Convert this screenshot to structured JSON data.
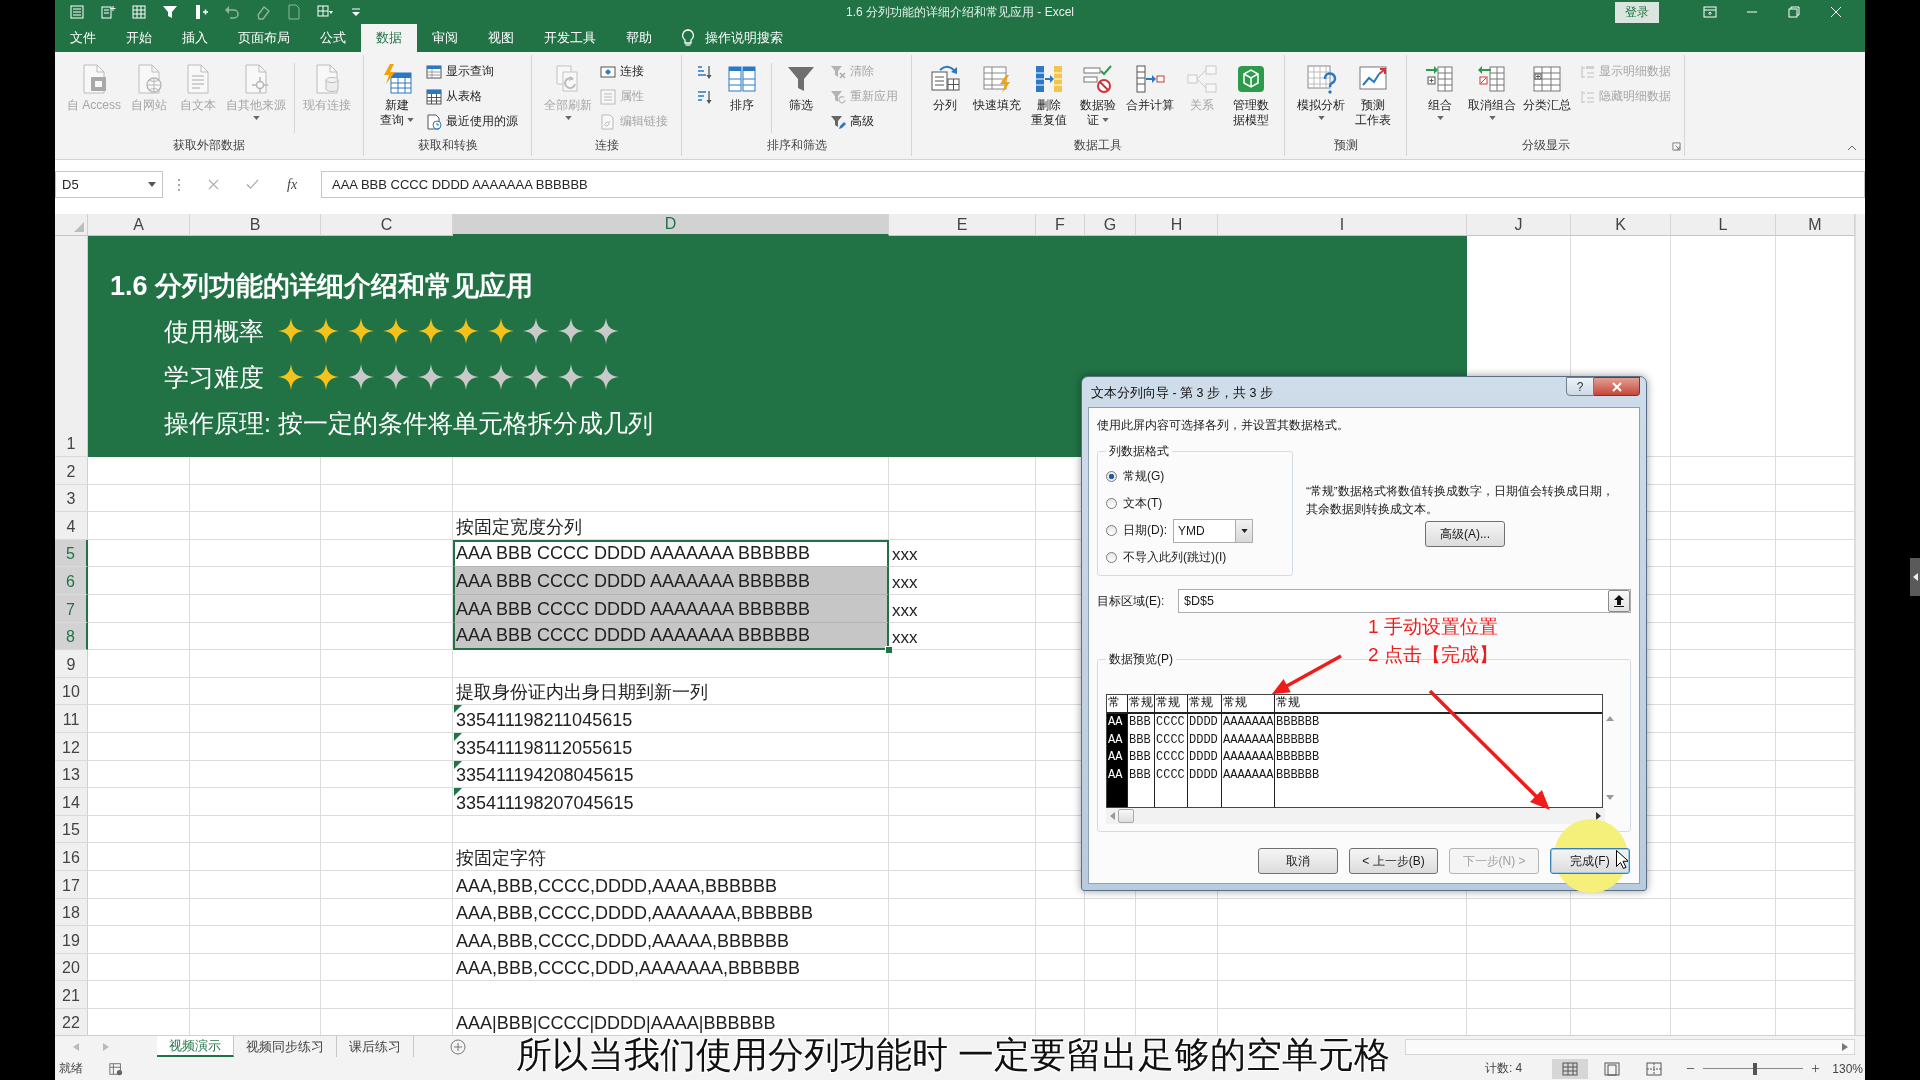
{
  "window": {
    "title": "1.6 分列功能的详细介绍和常见应用 - Excel",
    "sign_in": "登录"
  },
  "ribbon": {
    "tabs": [
      {
        "label": "文件",
        "selected": false
      },
      {
        "label": "开始",
        "selected": false
      },
      {
        "label": "插入",
        "selected": false
      },
      {
        "label": "页面布局",
        "selected": false
      },
      {
        "label": "公式",
        "selected": false
      },
      {
        "label": "数据",
        "selected": true
      },
      {
        "label": "审阅",
        "selected": false
      },
      {
        "label": "视图",
        "selected": false
      },
      {
        "label": "开发工具",
        "selected": false
      },
      {
        "label": "帮助",
        "selected": false
      }
    ],
    "tell_me": "操作说明搜索",
    "groups": [
      {
        "label": "获取外部数据",
        "launcher": false,
        "columns": [
          {
            "kind": "large",
            "lines": [
              "自 Access"
            ],
            "disabled": true,
            "dropdown": false
          },
          {
            "kind": "large",
            "lines": [
              "自网站"
            ],
            "disabled": true,
            "dropdown": false
          },
          {
            "kind": "large",
            "lines": [
              "自文本"
            ],
            "disabled": true,
            "dropdown": false
          },
          {
            "kind": "large",
            "lines": [
              "自其他来源"
            ],
            "disabled": true,
            "dropdown": true
          },
          {
            "kind": "divider"
          },
          {
            "kind": "large",
            "lines": [
              "现有连接"
            ],
            "disabled": true,
            "dropdown": false
          }
        ]
      },
      {
        "label": "获取和转换",
        "launcher": false,
        "columns": [
          {
            "kind": "large",
            "lines": [
              "新建",
              "查询"
            ],
            "disabled": false,
            "dropdown": true
          },
          {
            "kind": "stack",
            "buttons": [
              {
                "kind": "small",
                "label": "显示查询",
                "disabled": false
              },
              {
                "kind": "small",
                "label": "从表格",
                "disabled": false
              },
              {
                "kind": "small",
                "label": "最近使用的源",
                "disabled": false
              }
            ]
          }
        ]
      },
      {
        "label": "连接",
        "launcher": false,
        "columns": [
          {
            "kind": "large",
            "lines": [
              "全部刷新"
            ],
            "disabled": true,
            "dropdown": true
          },
          {
            "kind": "stack",
            "buttons": [
              {
                "kind": "small",
                "label": "连接",
                "disabled": false
              },
              {
                "kind": "small",
                "label": "属性",
                "disabled": true
              },
              {
                "kind": "small",
                "label": "编辑链接",
                "disabled": true
              }
            ]
          }
        ]
      },
      {
        "label": "排序和筛选",
        "launcher": false,
        "columns": [
          {
            "kind": "stack",
            "buttons": [
              {
                "kind": "icon",
                "disabled": false
              },
              {
                "kind": "icon",
                "disabled": false
              }
            ]
          },
          {
            "kind": "large",
            "lines": [
              "排序"
            ],
            "disabled": false,
            "dropdown": false
          },
          {
            "kind": "divider"
          },
          {
            "kind": "large",
            "lines": [
              "筛选"
            ],
            "disabled": false,
            "dropdown": false
          },
          {
            "kind": "stack",
            "buttons": [
              {
                "kind": "small",
                "label": "清除",
                "disabled": true
              },
              {
                "kind": "small",
                "label": "重新应用",
                "disabled": true
              },
              {
                "kind": "small",
                "label": "高级",
                "disabled": false
              }
            ]
          }
        ]
      },
      {
        "label": "数据工具",
        "launcher": false,
        "columns": [
          {
            "kind": "large",
            "lines": [
              "分列"
            ],
            "disabled": false,
            "dropdown": false
          },
          {
            "kind": "large",
            "lines": [
              "快速填充"
            ],
            "disabled": false,
            "dropdown": false
          },
          {
            "kind": "large",
            "lines": [
              "删除",
              "重复值"
            ],
            "disabled": false,
            "dropdown": false
          },
          {
            "kind": "large",
            "lines": [
              "数据验",
              "证"
            ],
            "disabled": false,
            "dropdown": true
          },
          {
            "kind": "large",
            "lines": [
              "合并计算"
            ],
            "disabled": false,
            "dropdown": false
          },
          {
            "kind": "large",
            "lines": [
              "关系"
            ],
            "disabled": true,
            "dropdown": false
          },
          {
            "kind": "large",
            "lines": [
              "管理数",
              "据模型"
            ],
            "disabled": false,
            "dropdown": false
          }
        ]
      },
      {
        "label": "预测",
        "launcher": false,
        "columns": [
          {
            "kind": "large",
            "lines": [
              "模拟分析"
            ],
            "disabled": false,
            "dropdown": true
          },
          {
            "kind": "large",
            "lines": [
              "预测",
              "工作表"
            ],
            "disabled": false,
            "dropdown": false
          }
        ]
      },
      {
        "label": "分级显示",
        "launcher": true,
        "columns": [
          {
            "kind": "large",
            "lines": [
              "组合"
            ],
            "disabled": false,
            "dropdown": true
          },
          {
            "kind": "large",
            "lines": [
              "取消组合"
            ],
            "disabled": false,
            "dropdown": true
          },
          {
            "kind": "large",
            "lines": [
              "分类汇总"
            ],
            "disabled": false,
            "dropdown": false
          },
          {
            "kind": "stack",
            "buttons": [
              {
                "kind": "small",
                "label": "显示明细数据",
                "disabled": true
              },
              {
                "kind": "small",
                "label": "隐藏明细数据",
                "disabled": true
              }
            ]
          }
        ]
      }
    ]
  },
  "formula_bar": {
    "name_box": "D5",
    "function_label": "fx",
    "value": "AAA BBB CCCC DDDD AAAAAAA BBBBBB"
  },
  "sheet": {
    "columns": [
      {
        "label": "A",
        "selected": false
      },
      {
        "label": "B",
        "selected": false
      },
      {
        "label": "C",
        "selected": false
      },
      {
        "label": "D",
        "selected": true
      },
      {
        "label": "E",
        "selected": false
      },
      {
        "label": "F",
        "selected": false
      },
      {
        "label": "G",
        "selected": false
      },
      {
        "label": "H",
        "selected": false
      },
      {
        "label": "I",
        "selected": false
      },
      {
        "label": "J",
        "selected": false
      },
      {
        "label": "K",
        "selected": false
      },
      {
        "label": "L",
        "selected": false
      },
      {
        "label": "M",
        "selected": false
      }
    ],
    "rows": [
      {
        "label": "1",
        "selected": false,
        "banner": {
          "title": "1.6 分列功能的详细介绍和常见应用",
          "ratings": [
            {
              "label": "使用概率",
              "stars": 7
            },
            {
              "label": "学习难度",
              "stars": 2
            }
          ],
          "principle": "操作原理: 按一定的条件将单元格拆分成几列"
        }
      },
      {
        "label": "2",
        "selected": false
      },
      {
        "label": "3",
        "selected": false
      },
      {
        "label": "4",
        "selected": false,
        "column_d": {
          "text": "按固定宽度分列",
          "selected": false,
          "active": false,
          "flagged": false
        }
      },
      {
        "label": "5",
        "selected": true,
        "column_d": {
          "text": "AAA BBB CCCC DDDD AAAAAAA BBBBBB",
          "selected": true,
          "active": true,
          "flagged": false
        },
        "column_e": {
          "text": "xxx"
        }
      },
      {
        "label": "6",
        "selected": true,
        "column_d": {
          "text": "AAA BBB CCCC DDDD AAAAAAA BBBBBB",
          "selected": true,
          "active": false,
          "flagged": false
        },
        "column_e": {
          "text": "xxx"
        }
      },
      {
        "label": "7",
        "selected": true,
        "column_d": {
          "text": "AAA BBB CCCC DDDD AAAAAAA BBBBBB",
          "selected": true,
          "active": false,
          "flagged": false
        },
        "column_e": {
          "text": "xxx"
        }
      },
      {
        "label": "8",
        "selected": true,
        "column_d": {
          "text": "AAA BBB CCCC DDDD AAAAAAA BBBBBB",
          "selected": true,
          "active": false,
          "flagged": false
        },
        "column_e": {
          "text": "xxx"
        }
      },
      {
        "label": "9",
        "selected": false
      },
      {
        "label": "10",
        "selected": false,
        "column_d": {
          "text": "提取身份证内出身日期到新一列",
          "selected": false,
          "active": false,
          "flagged": false
        }
      },
      {
        "label": "11",
        "selected": false,
        "column_d": {
          "text": "335411198211045615",
          "selected": false,
          "active": false,
          "flagged": true
        }
      },
      {
        "label": "12",
        "selected": false,
        "column_d": {
          "text": "335411198112055615",
          "selected": false,
          "active": false,
          "flagged": true
        }
      },
      {
        "label": "13",
        "selected": false,
        "column_d": {
          "text": "335411194208045615",
          "selected": false,
          "active": false,
          "flagged": true
        }
      },
      {
        "label": "14",
        "selected": false,
        "column_d": {
          "text": "335411198207045615",
          "selected": false,
          "active": false,
          "flagged": true
        }
      },
      {
        "label": "15",
        "selected": false
      },
      {
        "label": "16",
        "selected": false,
        "column_d": {
          "text": "按固定字符",
          "selected": false,
          "active": false,
          "flagged": false
        }
      },
      {
        "label": "17",
        "selected": false,
        "column_d": {
          "text": "AAA,BBB,CCCC,DDDD,AAAA,BBBBBB",
          "selected": false,
          "active": false,
          "flagged": false
        }
      },
      {
        "label": "18",
        "selected": false,
        "column_d": {
          "text": "AAA,BBB,CCCC,DDDD,AAAAAAA,BBBBBB",
          "selected": false,
          "active": false,
          "flagged": false
        }
      },
      {
        "label": "19",
        "selected": false,
        "column_d": {
          "text": "AAA,BBB,CCCC,DDDD,AAAAA,BBBBBB",
          "selected": false,
          "active": false,
          "flagged": false
        }
      },
      {
        "label": "20",
        "selected": false,
        "column_d": {
          "text": "AAA,BBB,CCCC,DDD,AAAAAAA,BBBBBB",
          "selected": false,
          "active": false,
          "flagged": false
        }
      },
      {
        "label": "21",
        "selected": false
      },
      {
        "label": "22",
        "selected": false,
        "column_d": {
          "text": "AAA|BBB|CCCC|DDDD|AAAA|BBBBBB",
          "selected": false,
          "active": false,
          "flagged": false
        }
      }
    ]
  },
  "sheet_tabs": [
    {
      "label": "视频演示",
      "selected": true
    },
    {
      "label": "视频同步练习",
      "selected": false
    },
    {
      "label": "课后练习",
      "selected": false
    }
  ],
  "status_bar": {
    "mode": "就绪",
    "count": "计数: 4",
    "views": [
      {
        "selected": true
      },
      {
        "selected": false
      },
      {
        "selected": false
      }
    ],
    "zoom": {
      "level": 0.52,
      "label": "130%"
    }
  },
  "dialog": {
    "title": "文本分列向导 - 第 3 步，共 3 步",
    "help_button": "?",
    "instruction": "使用此屏内容可选择各列，并设置其数据格式。",
    "format_group": {
      "label": "列数据格式",
      "options": [
        {
          "label": "常规(G)",
          "selected": true
        },
        {
          "label": "文本(T)",
          "selected": false
        },
        {
          "label": "日期(D):",
          "selected": false,
          "format": "YMD"
        },
        {
          "label": "不导入此列(跳过)(I)",
          "selected": false
        }
      ]
    },
    "note": "“常规”数据格式将数值转换成数字，日期值会转换成日期，其余数据则转换成文本。",
    "advanced_button": "高级(A)...",
    "destination": {
      "label": "目标区域(E):",
      "value": "$D$5"
    },
    "preview": {
      "label": "数据预览(P)",
      "columns": [
        {
          "header": "常",
          "selected": true
        },
        {
          "header": "常规",
          "selected": false
        },
        {
          "header": "常规",
          "selected": false
        },
        {
          "header": "常规",
          "selected": false
        },
        {
          "header": "常规",
          "selected": false
        },
        {
          "header": "常规",
          "selected": false
        }
      ],
      "rows": [
        {
          "cells": [
            "AA",
            "BBB",
            "CCCC",
            "DDDD",
            "AAAAAAA",
            "BBBBBB"
          ]
        },
        {
          "cells": [
            "AA",
            "BBB",
            "CCCC",
            "DDDD",
            "AAAAAAA",
            "BBBBBB"
          ]
        },
        {
          "cells": [
            "AA",
            "BBB",
            "CCCC",
            "DDDD",
            "AAAAAAA",
            "BBBBBB"
          ]
        },
        {
          "cells": [
            "AA",
            "BBB",
            "CCCC",
            "DDDD",
            "AAAAAAA",
            "BBBBBB"
          ]
        }
      ]
    },
    "buttons": [
      {
        "label": "取消",
        "disabled": false,
        "default": false
      },
      {
        "label": "< 上一步(B)",
        "disabled": false,
        "default": false
      },
      {
        "label": "下一步(N) >",
        "disabled": true,
        "default": false
      },
      {
        "label": "完成(F)",
        "disabled": false,
        "default": true
      }
    ]
  },
  "annotation": {
    "lines": [
      "1 手动设置位置",
      "2 点击【完成】"
    ]
  },
  "subtitle": "所以当我们使用分列功能时 一定要留出足够的空单元格"
}
